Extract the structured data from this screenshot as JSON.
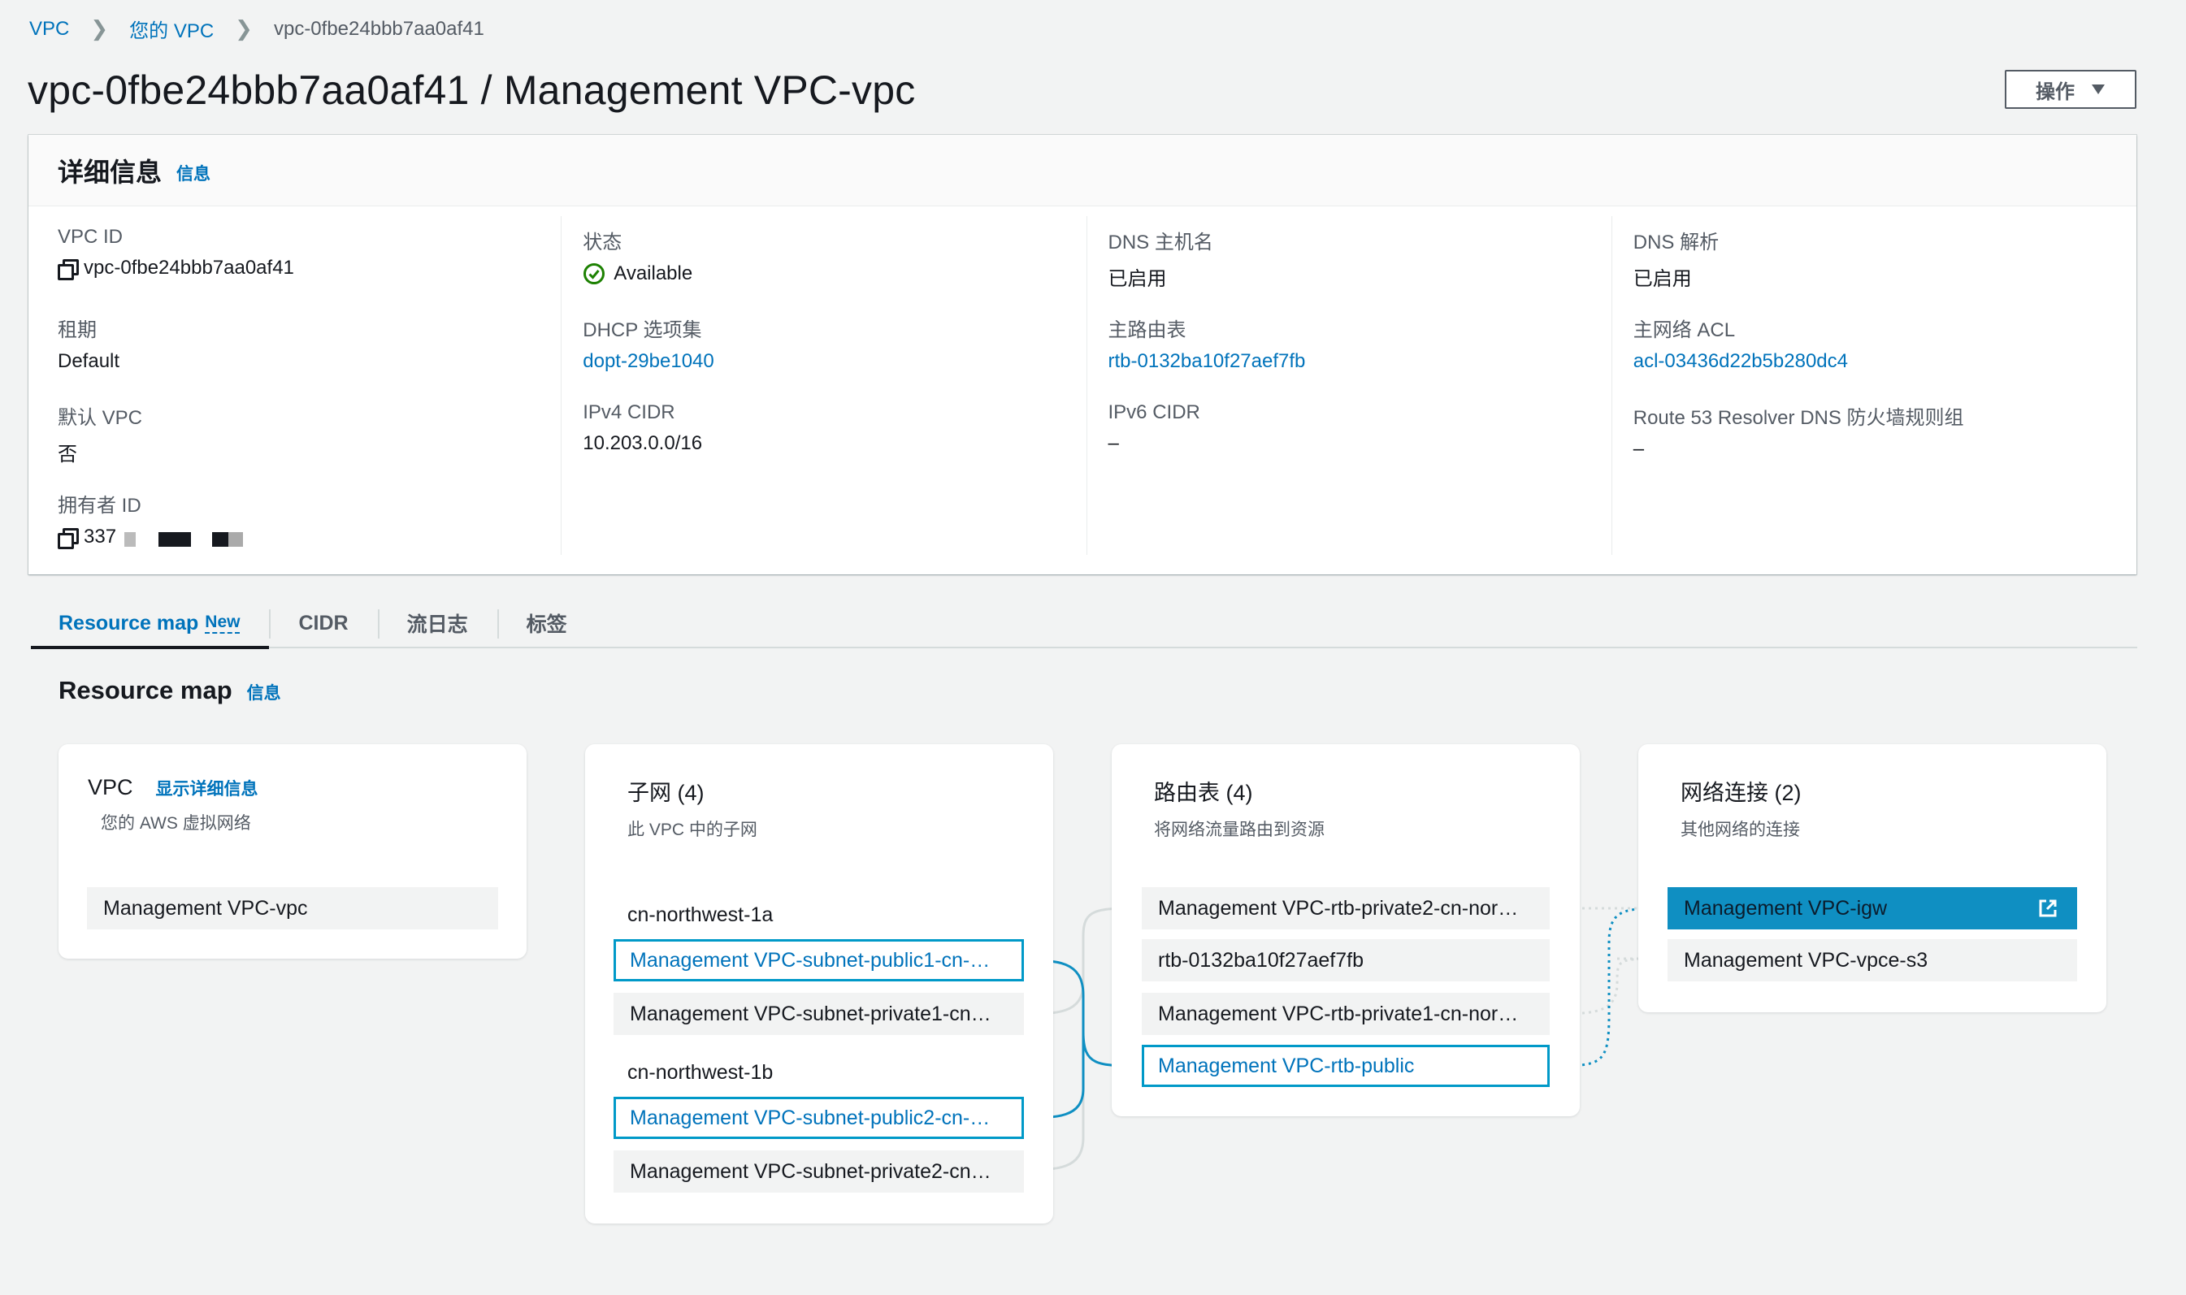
{
  "breadcrumb": {
    "root": "VPC",
    "parent": "您的 VPC",
    "current": "vpc-0fbe24bbb7aa0af41"
  },
  "page_title": "vpc-0fbe24bbb7aa0af41 / Management VPC-vpc",
  "actions_label": "操作",
  "details": {
    "title": "详细信息",
    "info": "信息",
    "col1": [
      {
        "key": "VPC ID",
        "value": "vpc-0fbe24bbb7aa0af41"
      },
      {
        "key": "租期",
        "value": "Default"
      },
      {
        "key": "默认 VPC",
        "value": "否"
      },
      {
        "key": "拥有者 ID",
        "value": "337"
      }
    ],
    "col2": [
      {
        "key": "状态",
        "value": "Available"
      },
      {
        "key": "DHCP 选项集",
        "value": "dopt-29be1040"
      },
      {
        "key": "IPv4 CIDR",
        "value": "10.203.0.0/16"
      }
    ],
    "col3": [
      {
        "key": "DNS 主机名",
        "value": "已启用"
      },
      {
        "key": "主路由表",
        "value": "rtb-0132ba10f27aef7fb"
      },
      {
        "key": "IPv6 CIDR",
        "value": "–"
      }
    ],
    "col4": [
      {
        "key": "DNS 解析",
        "value": "已启用"
      },
      {
        "key": "主网络 ACL",
        "value": "acl-03436d22b5b280dc4"
      },
      {
        "key": "Route 53 Resolver DNS 防火墙规则组",
        "value": "–"
      }
    ]
  },
  "tabs": [
    {
      "label": "Resource map",
      "badge": "New"
    },
    {
      "label": "CIDR"
    },
    {
      "label": "流日志"
    },
    {
      "label": "标签"
    }
  ],
  "resource_map": {
    "title": "Resource map",
    "info": "信息",
    "vpc": {
      "title": "VPC",
      "link": "显示详细信息",
      "subtitle": "您的 AWS 虚拟网络",
      "item": "Management VPC-vpc"
    },
    "subnets": {
      "title": "子网 (4)",
      "subtitle": "此 VPC 中的子网",
      "az1": "cn-northwest-1a",
      "az1_items": [
        "Management VPC-subnet-public1-cn-…",
        "Management VPC-subnet-private1-cn…"
      ],
      "az2": "cn-northwest-1b",
      "az2_items": [
        "Management VPC-subnet-public2-cn-…",
        "Management VPC-subnet-private2-cn…"
      ]
    },
    "route_tables": {
      "title": "路由表 (4)",
      "subtitle": "将网络流量路由到资源",
      "items": [
        "Management VPC-rtb-private2-cn-nor…",
        "rtb-0132ba10f27aef7fb",
        "Management VPC-rtb-private1-cn-nor…",
        "Management VPC-rtb-public"
      ]
    },
    "connections": {
      "title": "网络连接 (2)",
      "subtitle": "其他网络的连接",
      "items": [
        "Management VPC-igw",
        "Management VPC-vpce-s3"
      ]
    }
  },
  "colors": {
    "link": "#0073bb",
    "success": "#1d8102",
    "highlight": "#0099c8",
    "selected": "#0f8fc2"
  }
}
